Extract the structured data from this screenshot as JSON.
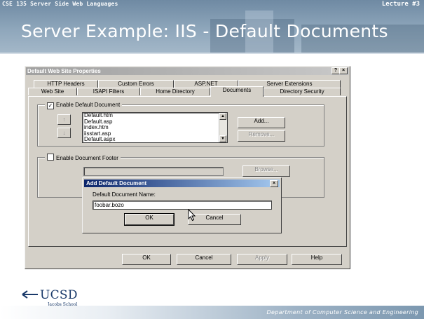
{
  "slide": {
    "course": "CSE 135   Server Side Web Languages",
    "lecture": "Lecture #3",
    "title": "Server Example: IIS - Default Documents",
    "footer": "Department of Computer Science and Engineering",
    "logo": {
      "name": "UCSD",
      "sub": "Jacobs School"
    }
  },
  "window": {
    "title": "Default Web Site Properties",
    "help_label": "?",
    "close_label": "×",
    "tabs_back": [
      "HTTP Headers",
      "Custom Errors",
      "ASP.NET",
      "Server Extensions"
    ],
    "tabs_front": [
      "Web Site",
      "ISAPI Filters",
      "Home Directory",
      "Documents",
      "Directory Security"
    ],
    "active_tab": "Documents",
    "enable_default_document": {
      "label": "Enable Default Document",
      "checked": true,
      "check_glyph": "✓"
    },
    "documents": [
      "Default.htm",
      "Default.asp",
      "index.htm",
      "iisstart.asp",
      "Default.aspx"
    ],
    "move_up_icon": "↑",
    "move_down_icon": "↓",
    "add_label": "Add...",
    "remove_label": "Remove...",
    "enable_footer": {
      "label": "Enable Document Footer",
      "checked": false
    },
    "browse_label": "Browse...",
    "ok_label": "OK",
    "cancel_label": "Cancel",
    "apply_label": "Apply",
    "help_button_label": "Help"
  },
  "dialog": {
    "title": "Add Default Document",
    "close_label": "×",
    "field_label": "Default Document Name:",
    "value": "foobar.bozo",
    "ok_label": "OK",
    "cancel_label": "Cancel"
  },
  "colors": {
    "title_bar_active": "#0a246a",
    "dialog_face": "#d4d0c8",
    "banner": "#8ea6bb"
  }
}
